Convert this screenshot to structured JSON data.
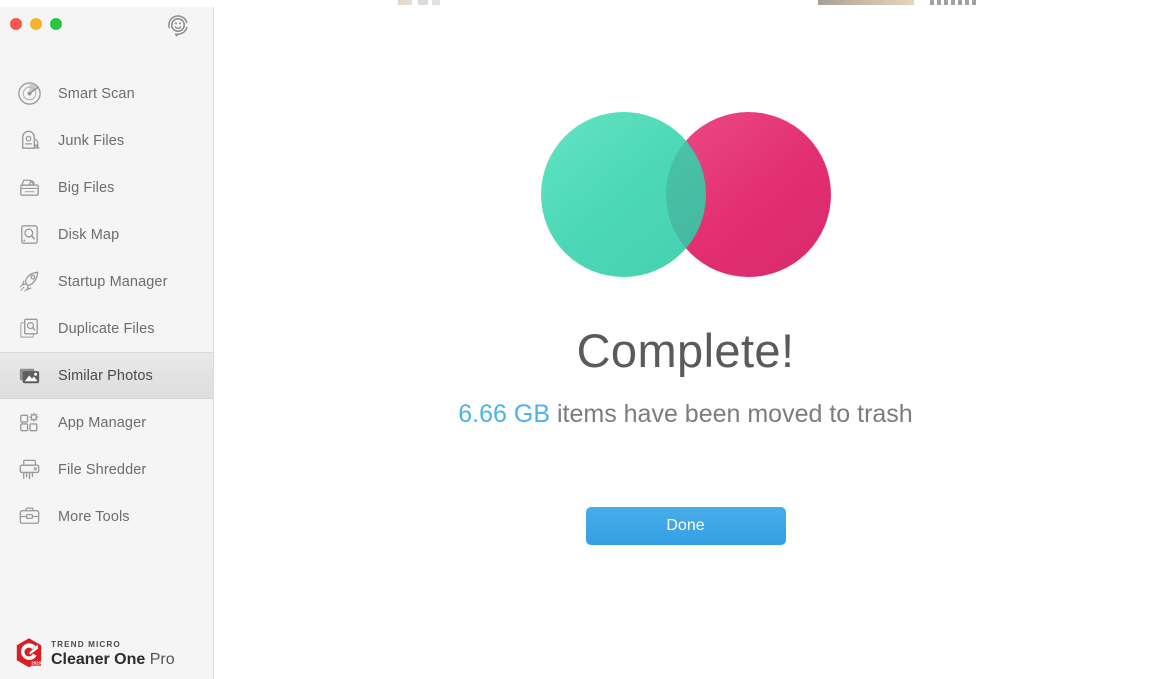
{
  "window": {
    "traffic_lights": [
      {
        "name": "close",
        "color": "#f4594f"
      },
      {
        "name": "minimize",
        "color": "#f5b330"
      },
      {
        "name": "maximize",
        "color": "#2bc644"
      }
    ],
    "support_icon": "support-headset-icon"
  },
  "sidebar": {
    "items": [
      {
        "label": "Smart Scan",
        "icon": "radar-icon",
        "active": false
      },
      {
        "label": "Junk Files",
        "icon": "vacuum-icon",
        "active": false
      },
      {
        "label": "Big Files",
        "icon": "basket-icon",
        "active": false
      },
      {
        "label": "Disk Map",
        "icon": "disk-search-icon",
        "active": false
      },
      {
        "label": "Startup Manager",
        "icon": "rocket-icon",
        "active": false
      },
      {
        "label": "Duplicate Files",
        "icon": "duplicate-docs-icon",
        "active": false
      },
      {
        "label": "Similar Photos",
        "icon": "photo-icon",
        "active": true
      },
      {
        "label": "App Manager",
        "icon": "apps-gear-icon",
        "active": false
      },
      {
        "label": "File Shredder",
        "icon": "shredder-icon",
        "active": false
      },
      {
        "label": "More Tools",
        "icon": "toolbox-icon",
        "active": false
      }
    ],
    "brand": {
      "company": "TREND MICRO",
      "product_bold": "Cleaner One",
      "product_light": " Pro",
      "logo_icon": "trend-micro-hexagon-logo",
      "logo_badge": "2020",
      "logo_color": "#d81f26"
    }
  },
  "main": {
    "illustration": {
      "name": "overlapping-circles-illustration",
      "green_color": "#33d3ac",
      "pink_color": "#e22e72"
    },
    "headline": "Complete!",
    "amount": "6.66 GB",
    "amount_color": "#4cb3e8",
    "subline_rest": " items have been moved to trash",
    "done_label": "Done",
    "done_color": "#3aa4e6"
  }
}
